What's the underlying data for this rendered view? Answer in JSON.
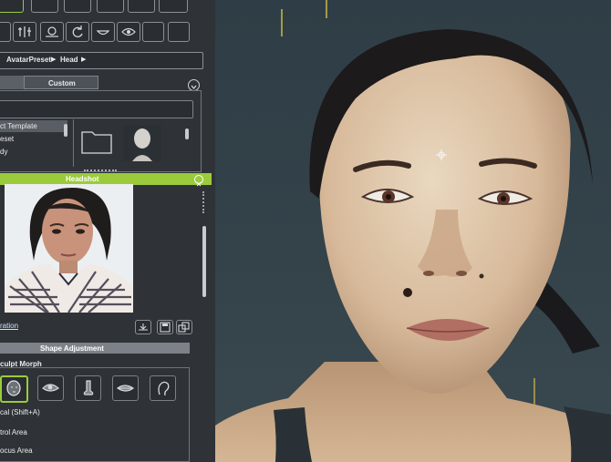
{
  "breadcrumb": {
    "root": "AvatarPreset",
    "child": "Head",
    "sep": "▶"
  },
  "tabs": {
    "custom": "Custom"
  },
  "tree": {
    "items": [
      "ct Template",
      "eset",
      "dy"
    ]
  },
  "headshot": {
    "title": "Headshot"
  },
  "links": {
    "generation": "ration"
  },
  "shape": {
    "title": "Shape Adjustment",
    "sculpt": "culpt Morph"
  },
  "options": {
    "local": "cal (Shift+A)",
    "control": "trol Area",
    "focus": "ocus Area"
  },
  "colors": {
    "accent": "#9bcb3b",
    "panel": "#2f3337",
    "viewport": "#34424a"
  },
  "icons": [
    "head-icon",
    "eye-icon",
    "nose-icon",
    "mouth-icon",
    "ear-icon"
  ]
}
